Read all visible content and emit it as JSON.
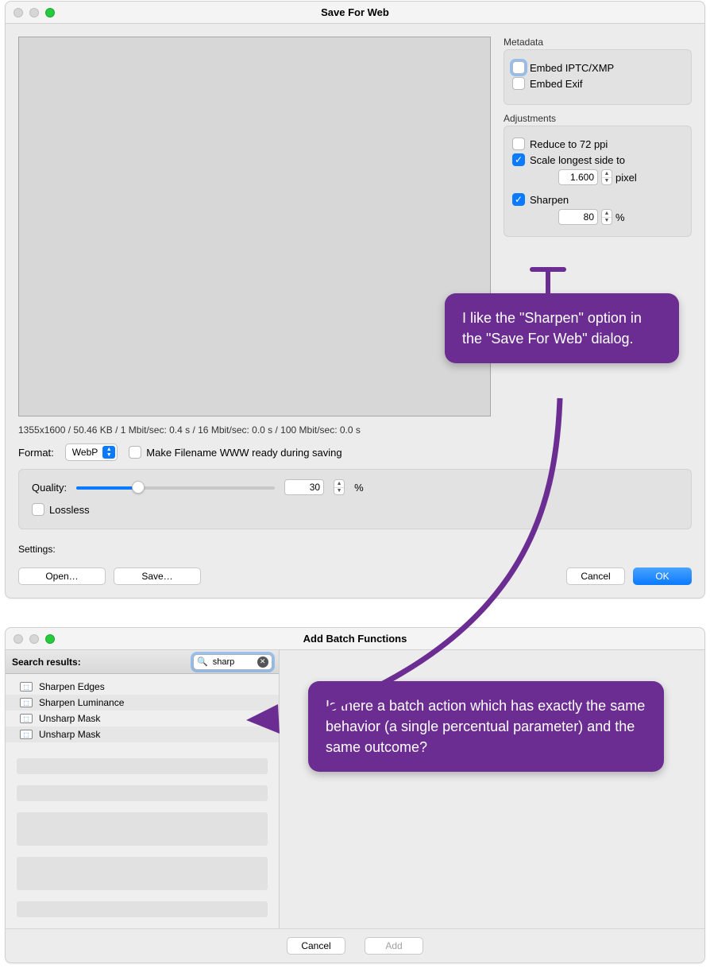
{
  "window1": {
    "title": "Save For Web",
    "metadata": {
      "label": "Metadata",
      "embed_iptc": "Embed IPTC/XMP",
      "embed_exif": "Embed Exif"
    },
    "adjustments": {
      "label": "Adjustments",
      "reduce": "Reduce to 72 ppi",
      "scale": "Scale longest side to",
      "scale_value": "1.600",
      "scale_unit": "pixel",
      "sharpen": "Sharpen",
      "sharpen_value": "80",
      "sharpen_unit": "%"
    },
    "info": "1355x1600 / 50.46 KB / 1 Mbit/sec: 0.4 s / 16 Mbit/sec: 0.0 s / 100 Mbit/sec: 0.0 s",
    "format_label": "Format:",
    "format_value": "WebP",
    "filename_ready": "Make Filename WWW ready during saving",
    "quality_label": "Quality:",
    "quality_value": "30",
    "quality_unit": "%",
    "lossless": "Lossless",
    "settings_label": "Settings:",
    "open_btn": "Open…",
    "save_btn": "Save…",
    "cancel_btn": "Cancel",
    "ok_btn": "OK"
  },
  "annot1": "I like the \"Sharpen\" option in the \"Save For Web\" dialog.",
  "window2": {
    "title": "Add Batch Functions",
    "search_label": "Search results:",
    "search_value": "sharp",
    "items": [
      "Sharpen Edges",
      "Sharpen Luminance",
      "Unsharp Mask",
      "Unsharp Mask"
    ],
    "cancel_btn": "Cancel",
    "add_btn": "Add"
  },
  "annot2": "Is there a batch action which has exactly the same behavior (a single percentual parameter) and the same outcome?"
}
